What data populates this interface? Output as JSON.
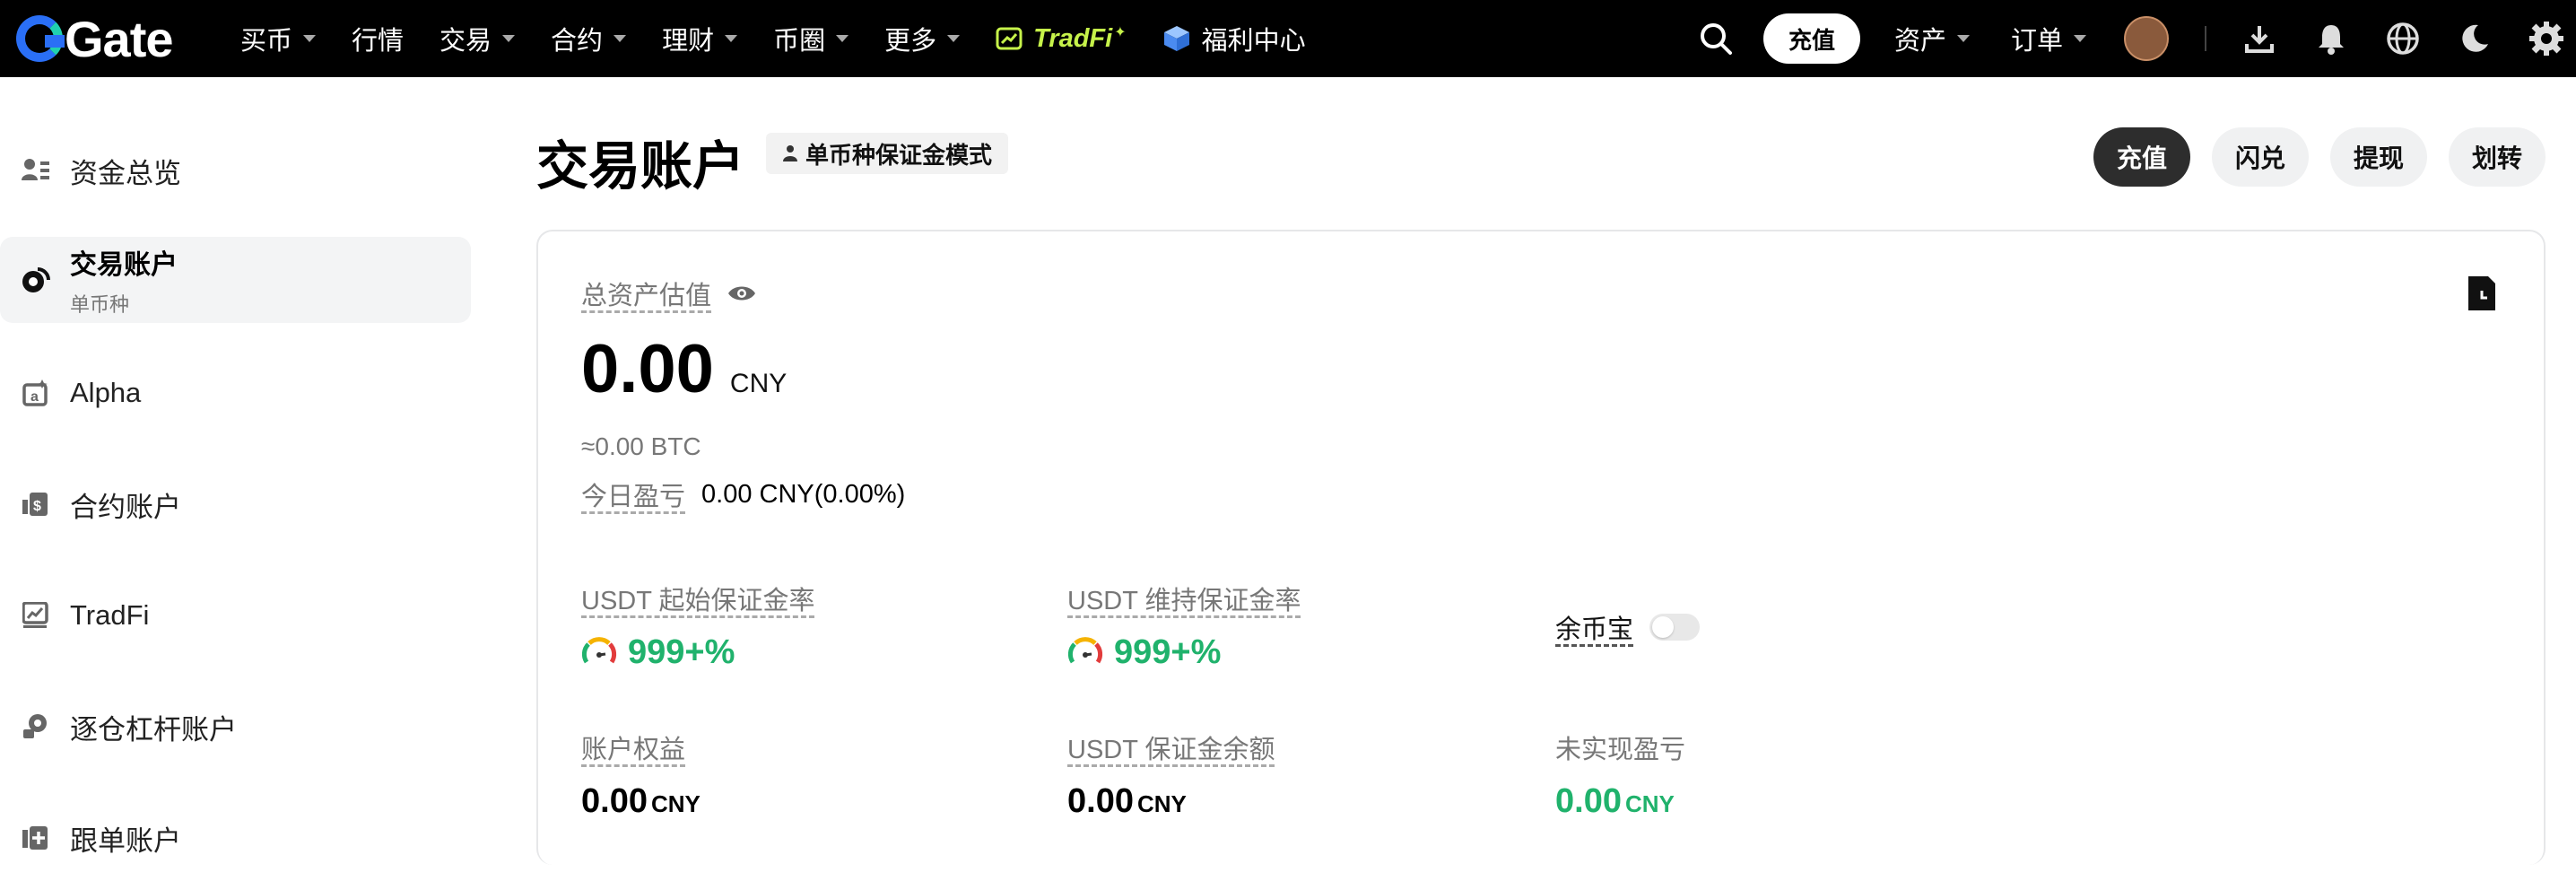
{
  "header": {
    "logo_text": "Gate",
    "nav": [
      {
        "label": "买币",
        "caret": true
      },
      {
        "label": "行情",
        "caret": false
      },
      {
        "label": "交易",
        "caret": true
      },
      {
        "label": "合约",
        "caret": true
      },
      {
        "label": "理财",
        "caret": true
      },
      {
        "label": "币圈",
        "caret": true
      },
      {
        "label": "更多",
        "caret": true
      }
    ],
    "tradfi_label": "TradFi",
    "fuli_label": "福利中心",
    "deposit_label": "充值",
    "assets_label": "资产",
    "orders_label": "订单"
  },
  "sidebar": {
    "items": [
      {
        "label": "资金总览",
        "icon": "wallet-icon"
      },
      {
        "label": "交易账户",
        "sublabel": "单币种",
        "icon": "spot-account-icon",
        "active": true
      },
      {
        "label": "Alpha",
        "icon": "alpha-icon"
      },
      {
        "label": "合约账户",
        "icon": "futures-account-icon"
      },
      {
        "label": "TradFi",
        "icon": "tradfi-icon"
      },
      {
        "label": "逐仓杠杆账户",
        "icon": "margin-account-icon"
      },
      {
        "label": "跟单账户",
        "icon": "copy-trading-icon"
      }
    ]
  },
  "main": {
    "title": "交易账户",
    "mode_badge": "单币种保证金模式",
    "actions": [
      "充值",
      "闪兑",
      "提现",
      "划转"
    ],
    "total_label": "总资产估值",
    "total_value": "0.00",
    "total_currency": "CNY",
    "btc_value": "≈0.00 BTC",
    "pnl_label": "今日盈亏",
    "pnl_value": "0.00 CNY(0.00%)",
    "metrics": {
      "initial_margin_label": "USDT 起始保证金率",
      "initial_margin_value": "999+%",
      "maint_margin_label": "USDT 维持保证金率",
      "maint_margin_value": "999+%",
      "yubibao_label": "余币宝",
      "equity_label": "账户权益",
      "equity_value": "0.00",
      "equity_currency": "CNY",
      "margin_balance_label": "USDT 保证金余额",
      "margin_balance_value": "0.00",
      "margin_balance_currency": "CNY",
      "unrealized_label": "未实现盈亏",
      "unrealized_value": "0.00",
      "unrealized_currency": "CNY"
    }
  },
  "colors": {
    "accent_green": "#20b26c",
    "tradfi": "#c6f24a",
    "brand_blue": "#2a6ff6"
  }
}
